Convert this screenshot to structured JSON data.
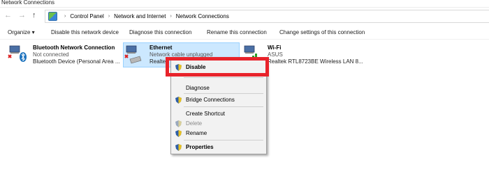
{
  "window": {
    "title": "Network Connections"
  },
  "nav": {
    "back": "←",
    "forward": "→",
    "up": "↑"
  },
  "breadcrumb": [
    "Control Panel",
    "Network and Internet",
    "Network Connections"
  ],
  "toolbar": {
    "organize": "Organize ▾",
    "disable": "Disable this network device",
    "diagnose": "Diagnose this connection",
    "rename": "Rename this connection",
    "change": "Change settings of this connection"
  },
  "connections": [
    {
      "name": "Bluetooth Network Connection",
      "status": "Not connected",
      "device": "Bluetooth Device (Personal Area ..."
    },
    {
      "name": "Ethernet",
      "status": "Network cable unplugged",
      "device": "Realtek"
    },
    {
      "name": "Wi-Fi",
      "status": "ASUS",
      "device": "Realtek RTL8723BE Wireless LAN 8..."
    }
  ],
  "context_menu": {
    "disable": "Disable",
    "diagnose": "Diagnose",
    "bridge": "Bridge Connections",
    "shortcut": "Create Shortcut",
    "delete": "Delete",
    "rename": "Rename",
    "properties": "Properties"
  },
  "colors": {
    "highlight_border": "#e8232b",
    "selection_bg": "#cce8ff",
    "menu_bg": "#f2f2f2"
  }
}
